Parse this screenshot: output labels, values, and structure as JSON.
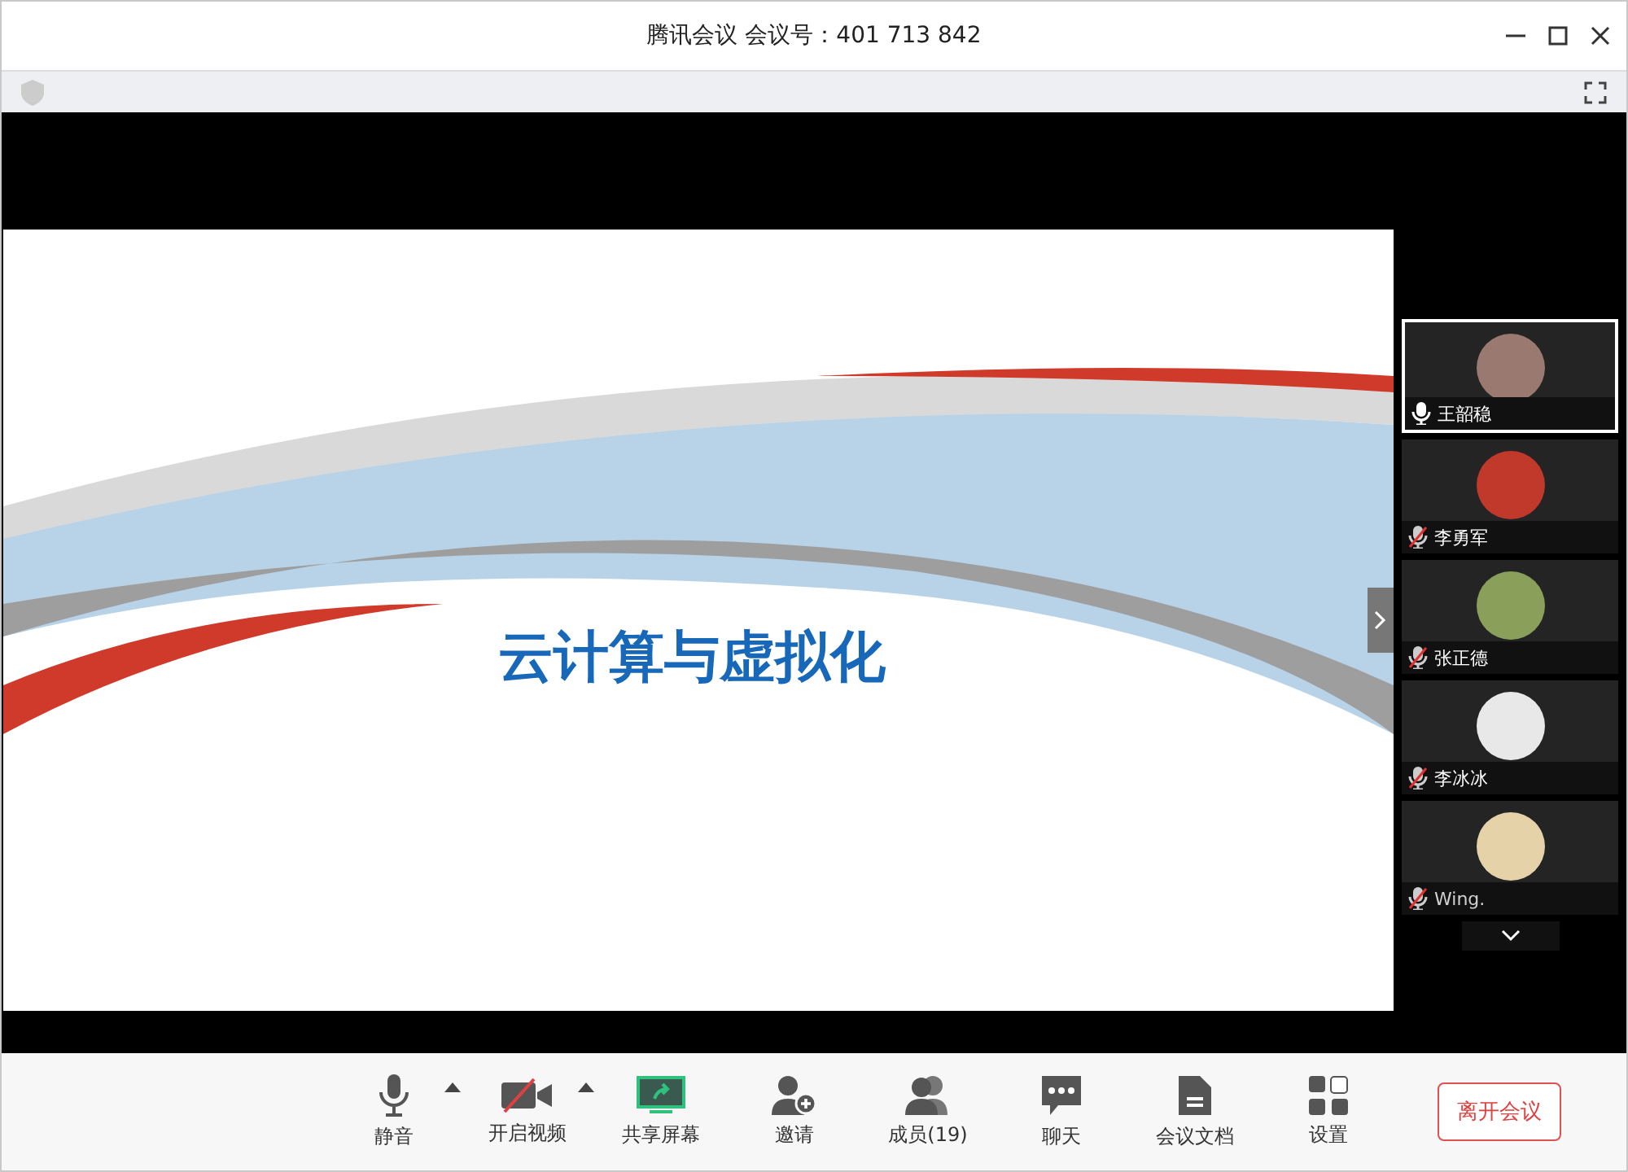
{
  "window": {
    "title": "腾讯会议 会议号：401 713 842"
  },
  "slide": {
    "title": "云计算与虚拟化"
  },
  "participants": [
    {
      "name": "王韶稳",
      "muted": false,
      "selected": true,
      "color": "#9a7a70"
    },
    {
      "name": "李勇军",
      "muted": true,
      "selected": false,
      "color": "#c0392b"
    },
    {
      "name": "张正德",
      "muted": true,
      "selected": false,
      "color": "#8aa05a"
    },
    {
      "name": "李冰冰",
      "muted": true,
      "selected": false,
      "color": "#e8e8e8"
    },
    {
      "name": "Wing.",
      "muted": true,
      "selected": false,
      "color": "#e6d2a8"
    }
  ],
  "toolbar": [
    {
      "kind": "mic",
      "label": "静音",
      "menu": true
    },
    {
      "kind": "video",
      "label": "开启视频",
      "menu": true,
      "off": true
    },
    {
      "kind": "share",
      "label": "共享屏幕",
      "menu": false
    },
    {
      "kind": "invite",
      "label": "邀请",
      "menu": false
    },
    {
      "kind": "members",
      "label": "成员(19)",
      "menu": false
    },
    {
      "kind": "chat",
      "label": "聊天",
      "menu": false
    },
    {
      "kind": "docs",
      "label": "会议文档",
      "menu": false
    },
    {
      "kind": "settings",
      "label": "设置",
      "menu": false
    }
  ],
  "leave_button": "离开会议"
}
